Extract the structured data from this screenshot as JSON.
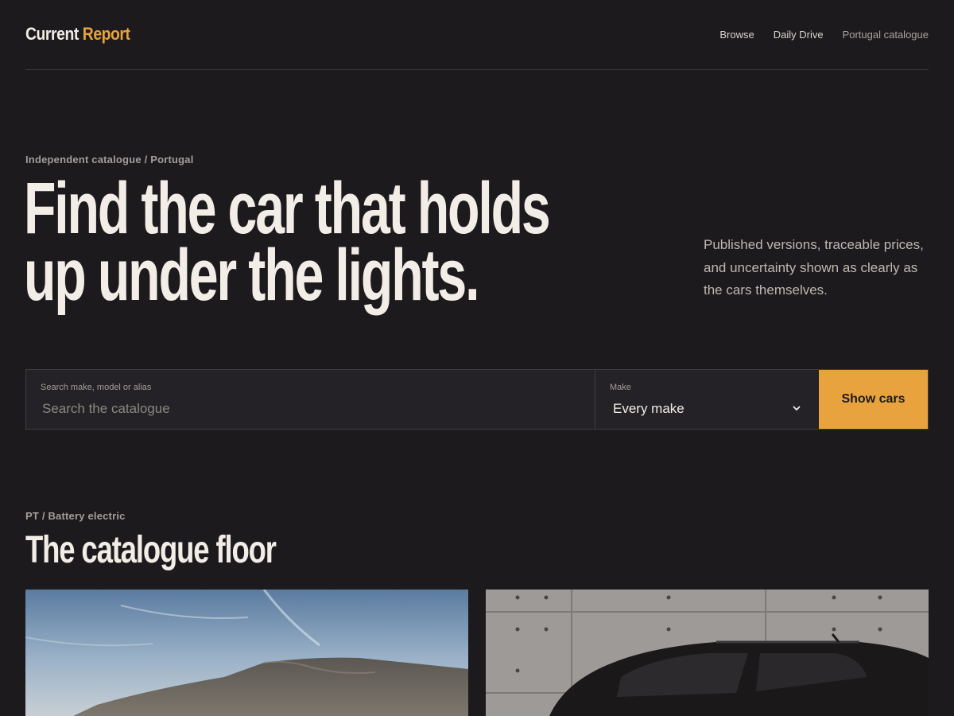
{
  "header": {
    "logo_part1": "Current",
    "logo_part2": "Report",
    "nav": [
      {
        "label": "Browse"
      },
      {
        "label": "Daily Drive"
      },
      {
        "label": "Portugal catalogue"
      }
    ]
  },
  "hero": {
    "eyebrow": "Independent catalogue / Portugal",
    "title_line1": "Find the car that holds",
    "title_line2": "up under the lights.",
    "description": "Published versions, traceable prices, and uncertainty shown as clearly as the cars themselves."
  },
  "search": {
    "query_label": "Search make, model or alias",
    "query_placeholder": "Search the catalogue",
    "query_value": "",
    "make_label": "Make",
    "make_value": "Every make",
    "submit_label": "Show cars"
  },
  "catalogue": {
    "eyebrow": "PT / Battery electric",
    "title": "The catalogue floor"
  },
  "colors": {
    "background": "#1c1a1d",
    "accent": "#e8a23e",
    "text": "#f2ede6"
  }
}
